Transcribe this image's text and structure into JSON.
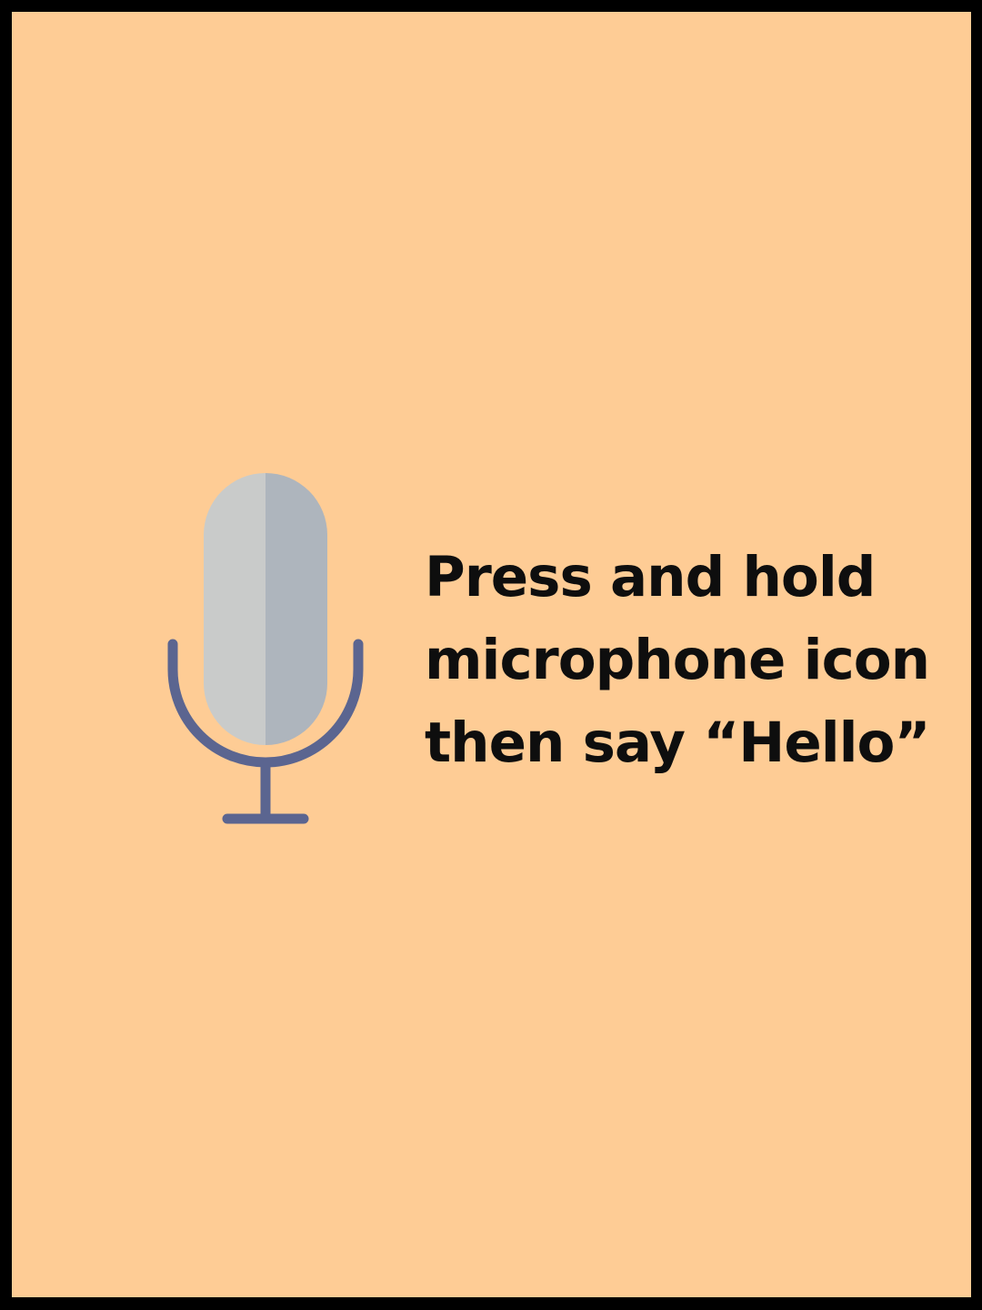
{
  "colors": {
    "background": "#FECC95",
    "frame": "#000000",
    "text": "#0E0E0E",
    "mic_capsule_light": "#C9CBCA",
    "mic_capsule_dark": "#AEB5BD",
    "mic_stand": "#5B6590"
  },
  "icon": {
    "name": "microphone-icon"
  },
  "instruction": {
    "lines": [
      "Press and hold",
      "microphone icon",
      "then say “Hello”"
    ]
  }
}
